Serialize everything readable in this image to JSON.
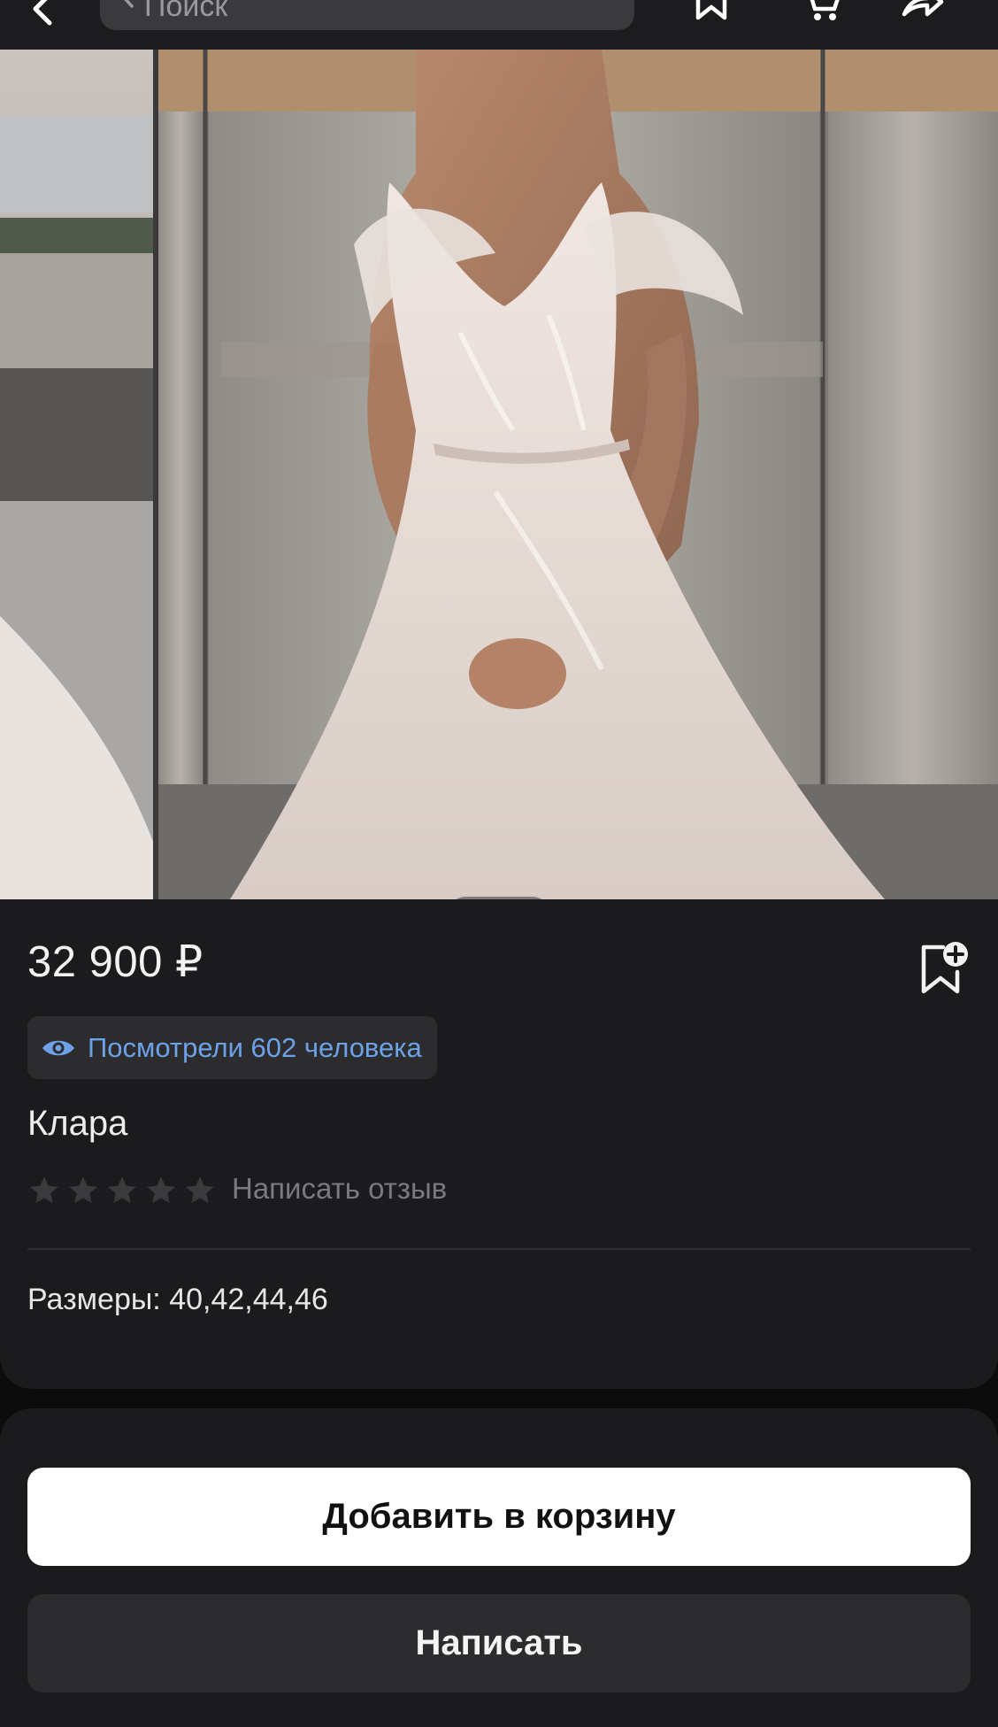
{
  "header": {
    "search_placeholder": "Поиск",
    "icons": [
      "back-arrow-icon",
      "bookmark-icon",
      "cart-icon",
      "share-icon"
    ]
  },
  "gallery": {
    "photo_count": 3,
    "active_index": 2
  },
  "product": {
    "price": "32 900 ₽",
    "views_text": "Посмотрели 602 человека",
    "name": "Клара",
    "rating_stars": 5,
    "rating_value": 0,
    "review_link": "Написать отзыв",
    "sizes": "Размеры: 40,42,44,46"
  },
  "actions": {
    "add_to_cart": "Добавить в корзину",
    "write": "Написать"
  },
  "colors": {
    "background": "#1b1b1d",
    "accent_link": "#6ea2e8",
    "button_primary": "#ffffff",
    "button_secondary": "#2c2c2e"
  }
}
